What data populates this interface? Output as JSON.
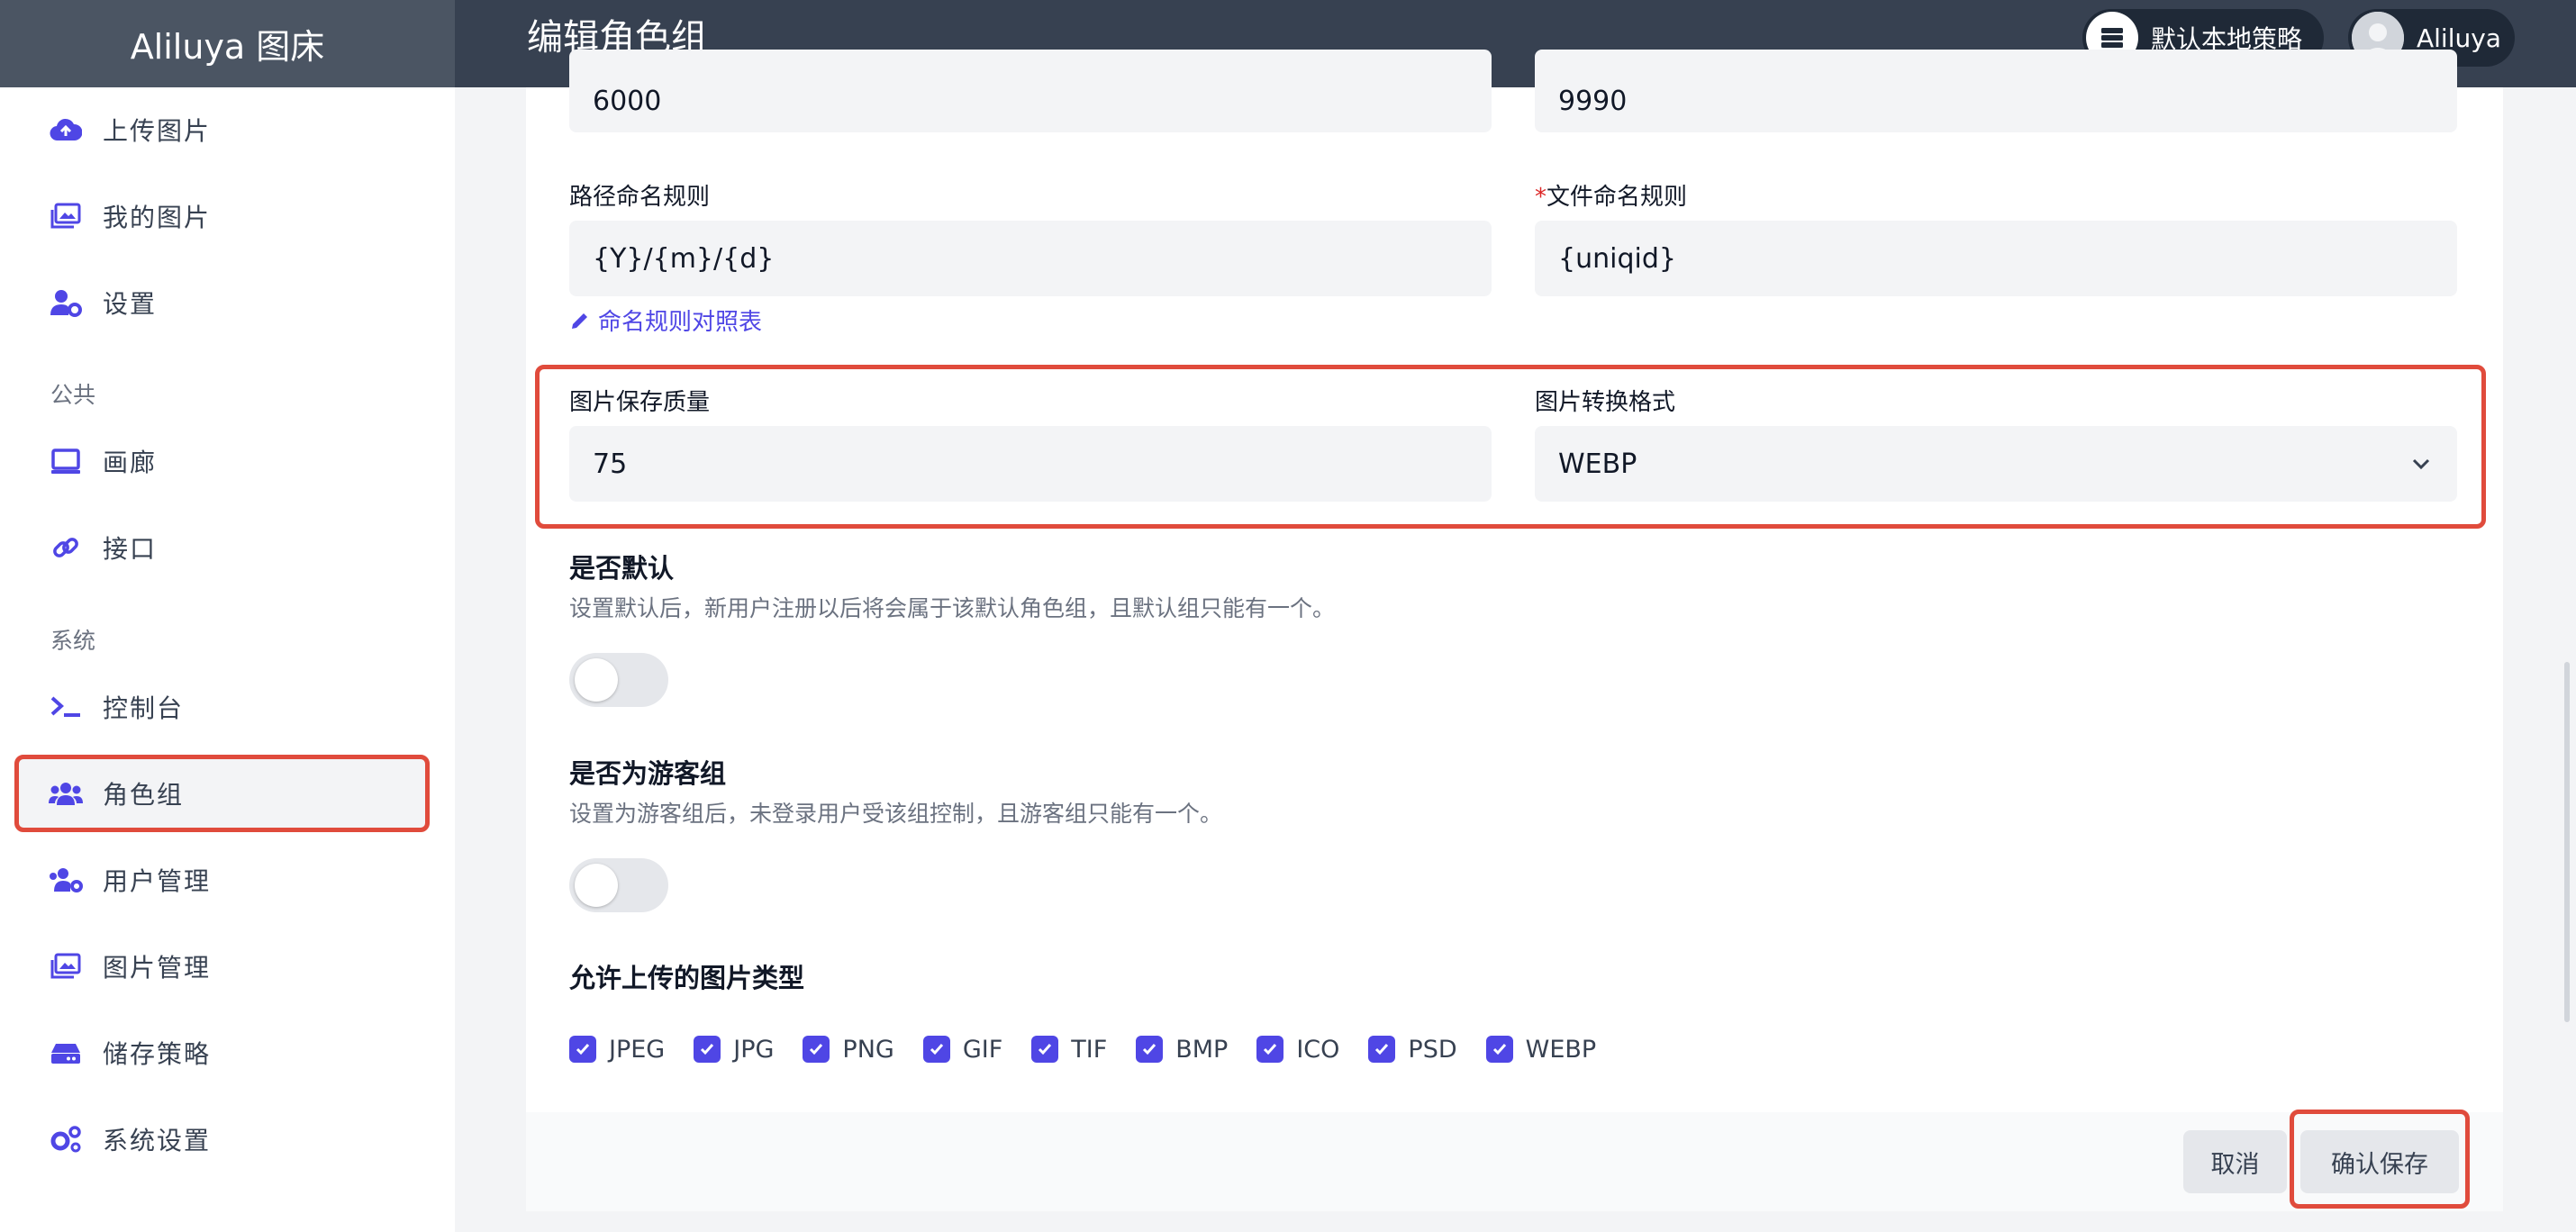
{
  "header": {
    "brand": "Aliluya 图床",
    "page_title": "编辑角色组",
    "strategy_label": "默认本地策略",
    "user_name": "Aliluya"
  },
  "sidebar": {
    "items_top": [
      {
        "label": "上传图片",
        "icon": "cloud-upload-icon"
      },
      {
        "label": "我的图片",
        "icon": "images-icon"
      },
      {
        "label": "设置",
        "icon": "user-cog-icon"
      }
    ],
    "section_public": "公共",
    "items_public": [
      {
        "label": "画廊",
        "icon": "monitor-icon"
      },
      {
        "label": "接口",
        "icon": "link-icon"
      }
    ],
    "section_system": "系统",
    "items_system": [
      {
        "label": "控制台",
        "icon": "terminal-icon"
      },
      {
        "label": "角色组",
        "icon": "users-icon",
        "active": true
      },
      {
        "label": "用户管理",
        "icon": "users-cog-icon"
      },
      {
        "label": "图片管理",
        "icon": "images-icon"
      },
      {
        "label": "储存策略",
        "icon": "hdd-icon"
      },
      {
        "label": "系统设置",
        "icon": "cogs-icon"
      }
    ]
  },
  "form": {
    "top_left_value": "6000",
    "top_right_value": "9990",
    "path_rule_label": "路径命名规则",
    "path_rule_value": "{Y}/{m}/{d}",
    "file_rule_required": "*",
    "file_rule_label": "文件命名规则",
    "file_rule_value": "{uniqid}",
    "naming_link": "命名规则对照表",
    "quality_label": "图片保存质量",
    "quality_value": "75",
    "format_label": "图片转换格式",
    "format_value": "WEBP",
    "default_title": "是否默认",
    "default_desc": "设置默认后，新用户注册以后将会属于该默认角色组，且默认组只能有一个。",
    "default_on": false,
    "guest_title": "是否为游客组",
    "guest_desc": "设置为游客组后，未登录用户受该组控制，且游客组只能有一个。",
    "guest_on": false,
    "types_title": "允许上传的图片类型",
    "types": [
      "JPEG",
      "JPG",
      "PNG",
      "GIF",
      "TIF",
      "BMP",
      "ICO",
      "PSD",
      "WEBP"
    ]
  },
  "buttons": {
    "cancel": "取消",
    "save": "确认保存"
  },
  "colors": {
    "accent": "#4f46e5",
    "highlight": "#e04b3c",
    "header_bg": "#374151"
  }
}
